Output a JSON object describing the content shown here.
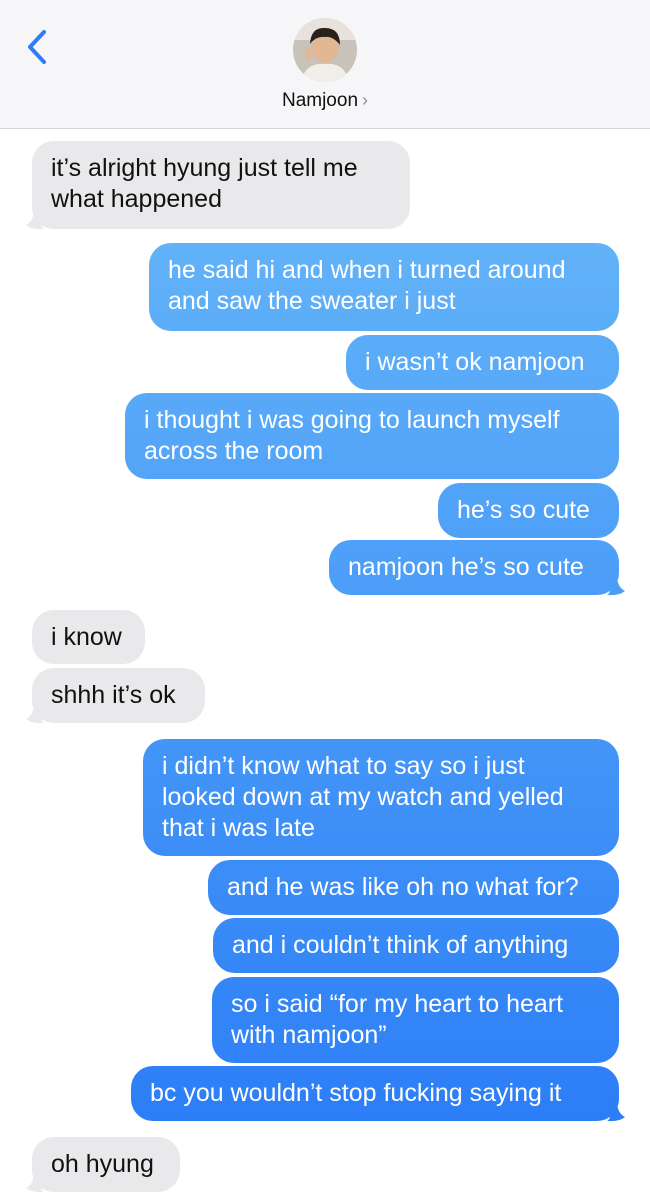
{
  "header": {
    "contact_name": "Namjoon",
    "chevron": "›",
    "back_icon": "chevron-left-icon",
    "accent": "#2f7cf6"
  },
  "colors": {
    "incoming": "#e9e9eb",
    "outgoing_top": "#61b2f8",
    "outgoing_bottom": "#2c7ef7"
  },
  "messages": [
    {
      "dir": "in",
      "lines": [
        "it’s alright hyung just tell me",
        "what happened"
      ]
    },
    {
      "dir": "out",
      "lines": [
        "he said hi and when i turned around",
        "and saw the sweater i just"
      ]
    },
    {
      "dir": "out",
      "lines": [
        "i wasn’t ok namjoon"
      ]
    },
    {
      "dir": "out",
      "lines": [
        "i thought i was going to launch myself",
        "across the room"
      ]
    },
    {
      "dir": "out",
      "lines": [
        "he’s so cute"
      ]
    },
    {
      "dir": "out",
      "lines": [
        "namjoon he’s so cute"
      ]
    },
    {
      "dir": "in",
      "lines": [
        "i know"
      ]
    },
    {
      "dir": "in",
      "lines": [
        "shhh it’s ok"
      ]
    },
    {
      "dir": "out",
      "lines": [
        "i didn’t know what to say so i just",
        "looked down at my watch and yelled",
        "that i was late"
      ]
    },
    {
      "dir": "out",
      "lines": [
        "and he was like oh no what for?"
      ]
    },
    {
      "dir": "out",
      "lines": [
        "and i couldn’t think of anything"
      ]
    },
    {
      "dir": "out",
      "lines": [
        "so i said “for my heart to heart",
        "with namjoon”"
      ]
    },
    {
      "dir": "out",
      "lines": [
        "bc you wouldn’t stop fucking saying it"
      ]
    },
    {
      "dir": "in",
      "lines": [
        "oh hyung"
      ]
    }
  ]
}
